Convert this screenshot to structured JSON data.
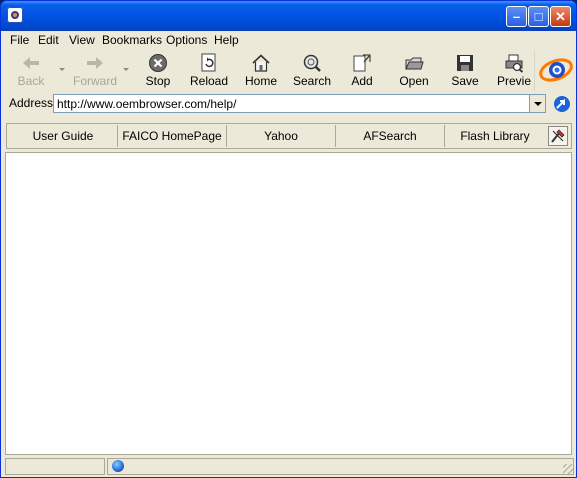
{
  "window": {
    "title": "",
    "buttons": {
      "minimize": "–",
      "maximize": "□",
      "close": "✕"
    }
  },
  "menu": [
    "File",
    "Edit",
    "View",
    "Bookmarks",
    "Options",
    "Help"
  ],
  "toolbar": {
    "back": {
      "label": "Back",
      "icon": "back-arrow-icon",
      "enabled": false
    },
    "forward": {
      "label": "Forward",
      "icon": "forward-arrow-icon",
      "enabled": false
    },
    "stop": {
      "label": "Stop",
      "icon": "stop-icon"
    },
    "reload": {
      "label": "Reload",
      "icon": "reload-icon"
    },
    "home": {
      "label": "Home",
      "icon": "home-icon"
    },
    "search": {
      "label": "Search",
      "icon": "search-icon"
    },
    "add": {
      "label": "Add",
      "icon": "add-bookmark-icon"
    },
    "open": {
      "label": "Open",
      "icon": "open-folder-icon"
    },
    "save": {
      "label": "Save",
      "icon": "save-disk-icon"
    },
    "preview": {
      "label": "Previe",
      "icon": "print-preview-icon"
    }
  },
  "address": {
    "label": "Address:",
    "url": "http://www.oembrowser.com/help/"
  },
  "links": [
    "User Guide",
    "FAICO HomePage",
    "Yahoo",
    "AFSearch",
    "Flash Library"
  ],
  "colors": {
    "titlebar": "#0054e3",
    "chrome": "#ece9d8",
    "content": "#ffffff"
  }
}
